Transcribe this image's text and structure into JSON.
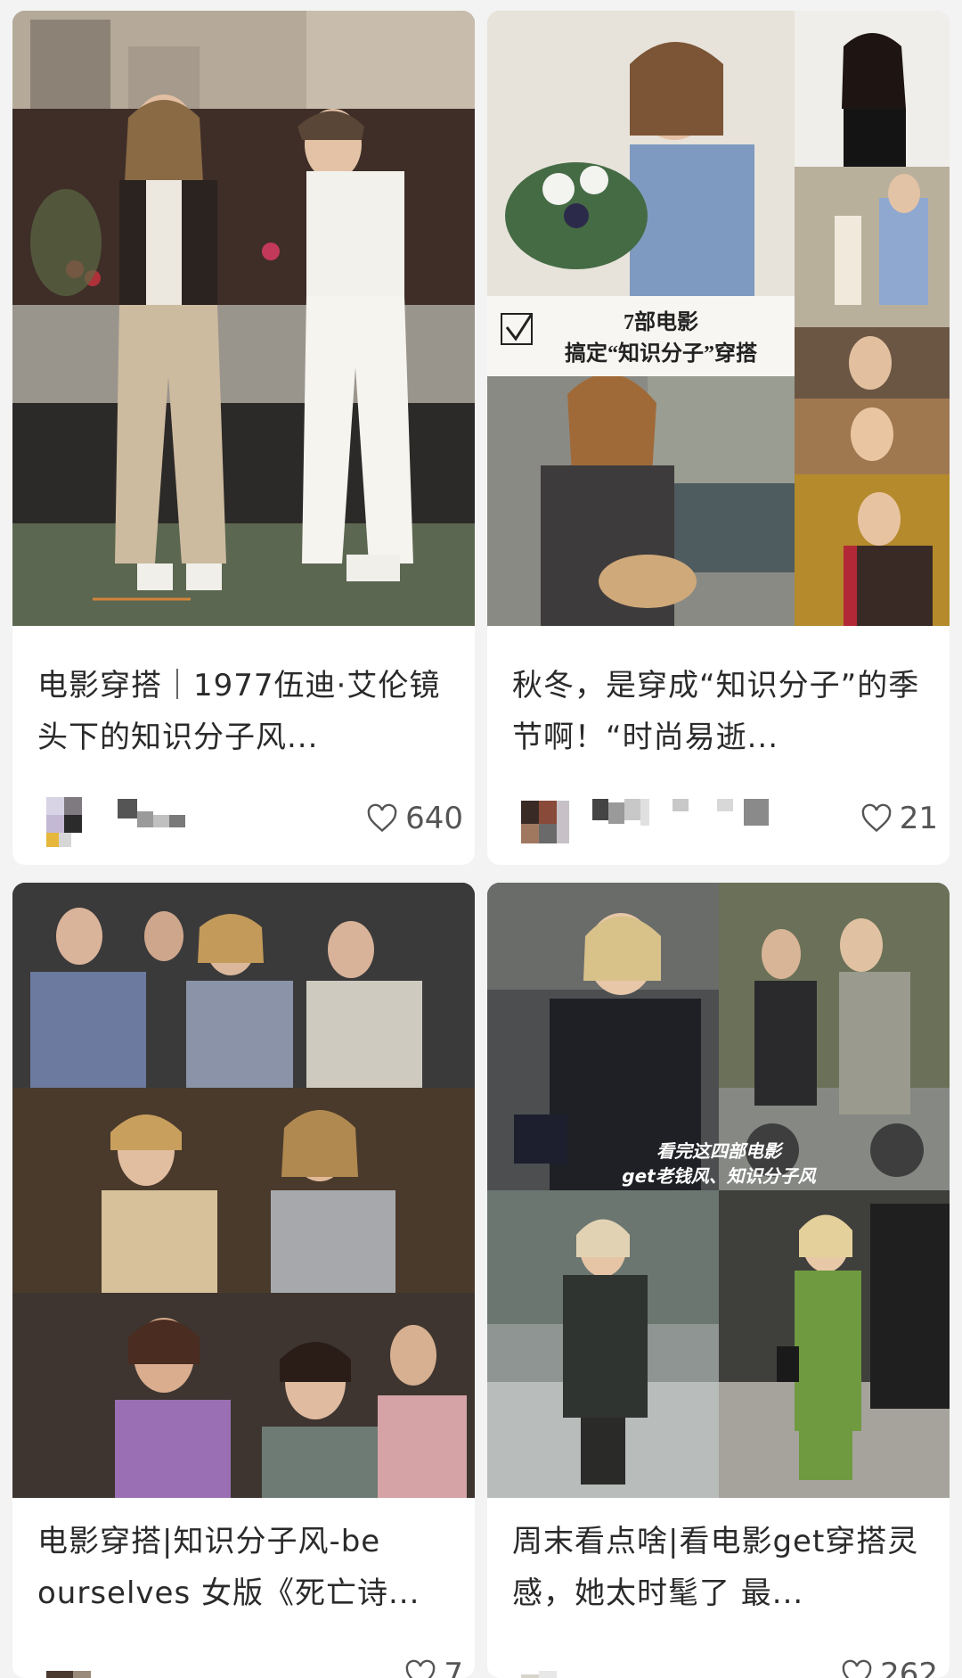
{
  "posts": [
    {
      "title": "电影穿搭｜1977伍迪·艾伦镜头下的知识分子风...",
      "likes": "640"
    },
    {
      "title": "秋冬，是穿成“知识分子”的季节啊！“时尚易逝...",
      "likes": "21",
      "cover_text_line1": "7部电影",
      "cover_text_line2": "搞定“知识分子”穿搭"
    },
    {
      "title": "电影穿搭|知识分子风-be ourselves 女版《死亡诗...",
      "likes": "7"
    },
    {
      "title": "周末看点啥|看电影get穿搭灵感，她太时髦了 最...",
      "likes": "262",
      "cover_text_line1": "看完这四部电影",
      "cover_text_line2": "get老钱风、知识分子风"
    }
  ],
  "icons": {
    "like": "heart-outline-icon"
  },
  "colors": {
    "background": "#f3f3f3",
    "card": "#ffffff",
    "title_text": "#2a2a2a",
    "like_text": "#555555"
  }
}
